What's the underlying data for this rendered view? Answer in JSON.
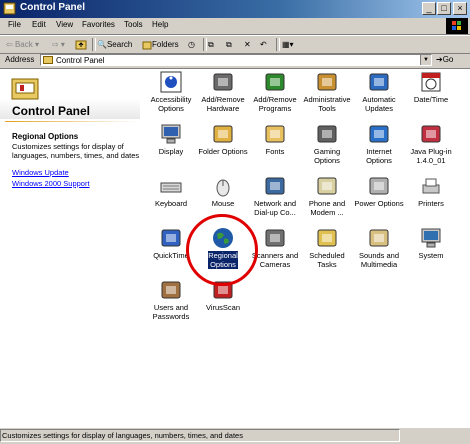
{
  "window": {
    "title": "Control Panel"
  },
  "menu": [
    "File",
    "Edit",
    "View",
    "Favorites",
    "Tools",
    "Help"
  ],
  "toolbar": {
    "back": "Back",
    "search": "Search",
    "folders": "Folders"
  },
  "address": {
    "label": "Address",
    "value": "Control Panel",
    "go": "Go"
  },
  "leftpane": {
    "title": "Control Panel",
    "section_title": "Regional Options",
    "description": "Customizes settings for display of languages, numbers, times, and dates",
    "links": [
      "Windows Update",
      "Windows 2000 Support"
    ]
  },
  "icons": [
    {
      "l1": "Accessibility",
      "l2": "Options",
      "icon": "accessibility-icon",
      "color": "#2050c0"
    },
    {
      "l1": "Add/Remove",
      "l2": "Hardware",
      "icon": "hardware-icon",
      "color": "#6a6a6a"
    },
    {
      "l1": "Add/Remove",
      "l2": "Programs",
      "icon": "programs-icon",
      "color": "#2c8a2c"
    },
    {
      "l1": "Administrative",
      "l2": "Tools",
      "icon": "admin-tools-icon",
      "color": "#c89030"
    },
    {
      "l1": "Automatic",
      "l2": "Updates",
      "icon": "windows-update-icon",
      "color": "#2c6ac0"
    },
    {
      "l1": "Date/Time",
      "l2": "",
      "icon": "clock-icon",
      "color": "#c02020"
    },
    {
      "l1": "Display",
      "l2": "",
      "icon": "display-icon",
      "color": "#3060b0"
    },
    {
      "l1": "Folder Options",
      "l2": "",
      "icon": "folder-options-icon",
      "color": "#e0b040"
    },
    {
      "l1": "Fonts",
      "l2": "",
      "icon": "fonts-icon",
      "color": "#e8c060"
    },
    {
      "l1": "Gaming",
      "l2": "Options",
      "icon": "joystick-icon",
      "color": "#606060"
    },
    {
      "l1": "Internet",
      "l2": "Options",
      "icon": "internet-icon",
      "color": "#2a70c8"
    },
    {
      "l1": "Java Plug-in",
      "l2": "1.4.0_01",
      "icon": "java-icon",
      "color": "#c03040"
    },
    {
      "l1": "Keyboard",
      "l2": "",
      "icon": "keyboard-icon",
      "color": "#707070"
    },
    {
      "l1": "Mouse",
      "l2": "",
      "icon": "mouse-icon",
      "color": "#c0c0c0"
    },
    {
      "l1": "Network and",
      "l2": "Dial-up Co...",
      "icon": "network-icon",
      "color": "#3a6aa0"
    },
    {
      "l1": "Phone and",
      "l2": "Modem ...",
      "icon": "phone-icon",
      "color": "#d8d0a0"
    },
    {
      "l1": "Power Options",
      "l2": "",
      "icon": "power-icon",
      "color": "#b0b0b0"
    },
    {
      "l1": "Printers",
      "l2": "",
      "icon": "printer-icon",
      "color": "#d0c060"
    },
    {
      "l1": "QuickTime",
      "l2": "",
      "icon": "quicktime-icon",
      "color": "#3060c0"
    },
    {
      "l1": "Regional",
      "l2": "Options",
      "icon": "globe-icon",
      "color": "#2a6ab0"
    },
    {
      "l1": "Scanners and",
      "l2": "Cameras",
      "icon": "scanner-icon",
      "color": "#707070"
    },
    {
      "l1": "Scheduled",
      "l2": "Tasks",
      "icon": "scheduled-tasks-icon",
      "color": "#e0c050"
    },
    {
      "l1": "Sounds and",
      "l2": "Multimedia",
      "icon": "speaker-icon",
      "color": "#d8c080"
    },
    {
      "l1": "System",
      "l2": "",
      "icon": "computer-icon",
      "color": "#3070b0"
    },
    {
      "l1": "Users and",
      "l2": "Passwords",
      "icon": "users-icon",
      "color": "#a07040"
    },
    {
      "l1": "VirusScan",
      "l2": "",
      "icon": "virusscan-icon",
      "color": "#c02020"
    }
  ],
  "status": {
    "text": "Customizes settings for display of languages, numbers, times, and dates"
  }
}
